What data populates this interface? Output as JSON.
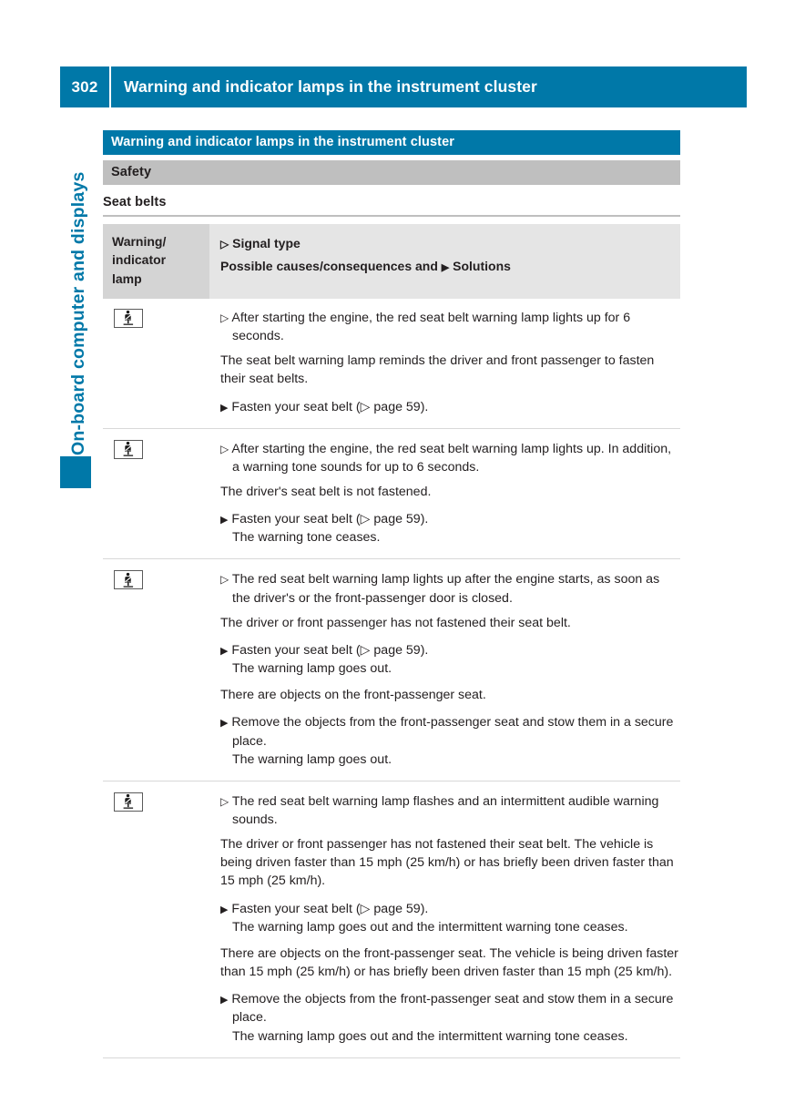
{
  "header": {
    "page_number": "302",
    "title": "Warning and indicator lamps in the instrument cluster"
  },
  "sidebar": {
    "chapter_label": "On-board computer and displays",
    "tab_marker": ""
  },
  "colors": {
    "accent_blue": "#0078a8",
    "subsection_gray": "#bfbfbf",
    "header_cell_gray": "#d4d4d4",
    "header_body_gray": "#e5e5e5",
    "rule_gray": "#d8d8d8",
    "text": "#231f20"
  },
  "section": {
    "bar_title": "Warning and indicator lamps in the instrument cluster",
    "subsection_title": "Safety",
    "group_title": "Seat belts"
  },
  "table": {
    "header": {
      "col_icon": "Warning/ indicator lamp",
      "col_icon_line1": "Warning/",
      "col_icon_line2": "indicator",
      "col_icon_line3": "lamp",
      "signal_type": "Signal type",
      "causes_prefix": "Possible causes/consequences and",
      "solutions": "Solutions"
    },
    "icon_name": "seat-belt-warning-lamp-icon",
    "rows": [
      {
        "signal": "After starting the engine, the red seat belt warning lamp lights up for 6 seconds.",
        "blocks": [
          {
            "cause": "The seat belt warning lamp reminds the driver and front passenger to fasten their seat belts.",
            "step": "Fasten your seat belt (▷ page 59).",
            "result": ""
          }
        ]
      },
      {
        "signal": "After starting the engine, the red seat belt warning lamp lights up. In addition, a warning tone sounds for up to 6 seconds.",
        "blocks": [
          {
            "cause": "The driver's seat belt is not fastened.",
            "step": "Fasten your seat belt (▷ page 59).",
            "result": "The warning tone ceases."
          }
        ]
      },
      {
        "signal": "The red seat belt warning lamp lights up after the engine starts, as soon as the driver's or the front-passenger door is closed.",
        "blocks": [
          {
            "cause": "The driver or front passenger has not fastened their seat belt.",
            "step": "Fasten your seat belt (▷ page 59).",
            "result": "The warning lamp goes out."
          },
          {
            "cause": "There are objects on the front-passenger seat.",
            "step": "Remove the objects from the front-passenger seat and stow them in a secure place.",
            "result": "The warning lamp goes out."
          }
        ]
      },
      {
        "signal": "The red seat belt warning lamp flashes and an intermittent audible warning sounds.",
        "blocks": [
          {
            "cause": "The driver or front passenger has not fastened their seat belt. The vehicle is being driven faster than 15 mph (25 km/h) or has briefly been driven faster than 15 mph (25 km/h).",
            "step": "Fasten your seat belt (▷ page 59).",
            "result": "The warning lamp goes out and the intermittent warning tone ceases."
          },
          {
            "cause": "There are objects on the front-passenger seat. The vehicle is being driven faster than 15 mph (25 km/h) or has briefly been driven faster than 15 mph (25 km/h).",
            "step": "Remove the objects from the front-passenger seat and stow them in a secure place.",
            "result": "The warning lamp goes out and the intermittent warning tone ceases."
          }
        ]
      }
    ]
  },
  "glyphs": {
    "signal_marker": "▷",
    "step_marker": "▶"
  }
}
